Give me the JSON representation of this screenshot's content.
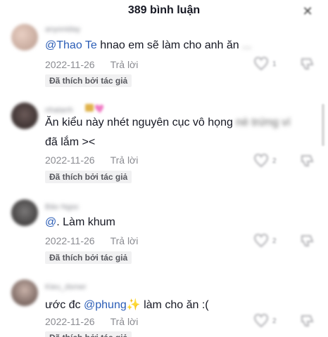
{
  "header": {
    "title": "389 bình luận"
  },
  "comments": [
    {
      "username": "anyoniday",
      "text_mention": "@Thao Te",
      "text": " hnao em sẽ làm cho anh ăn",
      "text_blurred": " ...",
      "date": "2022-11-26",
      "reply_label": "Trả lời",
      "liked_tag": "Đã thích bởi tác giả",
      "like_count": "1"
    },
    {
      "username": "nhatanh",
      "text": "Ăn kiểu này nhét nguyên cục vô họng",
      "text_blurred": " nè trứng ví",
      "text_line2": "đã lắm ><",
      "date": "2022-11-26",
      "reply_label": "Trả lời",
      "liked_tag": "Đã thích bởi tác giả",
      "like_count": "2"
    },
    {
      "username": "Bảo Ngọc",
      "text_mention": "@",
      "text": ". Làm khum",
      "date": "2022-11-26",
      "reply_label": "Trả lời",
      "liked_tag": "Đã thích bởi tác giả",
      "like_count": "2"
    },
    {
      "username": "Kieu_dsmer",
      "text_prefix": "ước đc ",
      "text_mention": "@phung",
      "text_emoji": "✨",
      "text": " làm cho ăn :(",
      "date": "2022-11-26",
      "reply_label": "Trả lời",
      "liked_tag": "Đã thích bởi tác giả",
      "like_count": "2"
    }
  ],
  "colors": {
    "mention": "#2b5db6",
    "muted": "#8a8b91",
    "text": "#161823",
    "tag_bg": "#f1f1f2"
  },
  "icons": [
    "close-icon",
    "heart-outline-icon",
    "dislike-icon",
    "heart-badge-icon"
  ]
}
